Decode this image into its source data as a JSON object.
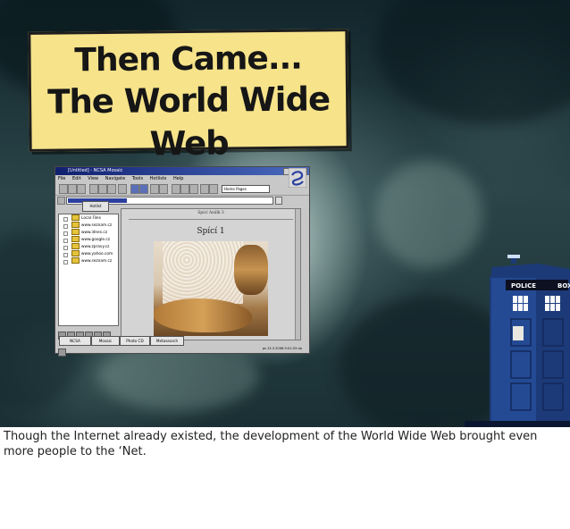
{
  "slide": {
    "title_line_1": "Then Came...",
    "title_line_2": "The World Wide Web",
    "caption": "Though the Internet already existed, the development of the World Wide Web brought even more people to the ‘Net."
  },
  "browser": {
    "window_title": "[Untitled] - NCSA Mosaic",
    "menu": [
      "File",
      "Edit",
      "View",
      "Navigate",
      "Tools",
      "Hotlists",
      "Help"
    ],
    "hotlist_combo": "Home Pages",
    "hotlist_button": "Hotlist",
    "tree_items": [
      "Local Files",
      "www.seznam.cz",
      "www.idnes.cz",
      "www.google.cz",
      "www.zpravy.cz",
      "www.yahoo.com",
      "www.seznam.cz"
    ],
    "page_small_heading": "Spící Azálk 3",
    "page_heading": "Spící 1",
    "bottom_buttons": [
      "NCSA",
      "Mosaic",
      "Photo CD",
      "Metasearch"
    ],
    "status_text": "ps 13.3 2008 9:01:53 dp"
  },
  "tardis": {
    "sign_left": "POLICE",
    "sign_right": "BOX"
  },
  "colors": {
    "title_box": "#f6e38a",
    "tardis_blue": "#1d3a78"
  }
}
